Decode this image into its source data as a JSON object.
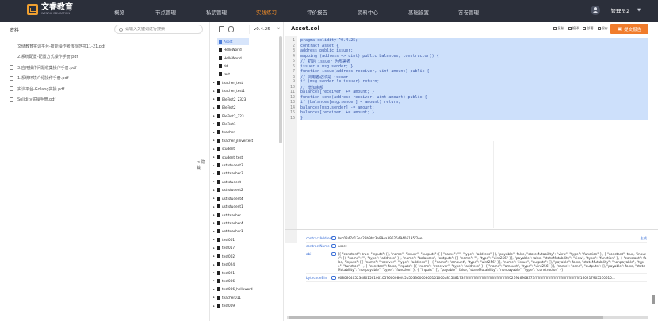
{
  "app": {
    "logo_cn": "文睿教育",
    "logo_en": "WENRUI EDUCATION"
  },
  "nav": {
    "items": [
      {
        "label": "概览",
        "active": false
      },
      {
        "label": "节点管理",
        "active": false
      },
      {
        "label": "私钥管理",
        "active": false
      },
      {
        "label": "实践练习",
        "active": true
      },
      {
        "label": "评价报告",
        "active": false
      },
      {
        "label": "资料中心",
        "active": false
      },
      {
        "label": "基础设置",
        "active": false
      },
      {
        "label": "答卷管理",
        "active": false
      }
    ],
    "user": "管理员2"
  },
  "left_panel": {
    "title": "资料",
    "search_placeholder": "请输入关键词进行搜索",
    "documents": [
      "文储教育实训平台-技能操作考核规范书11-21.pdf",
      "2.系统配置-配置方式操作手册.pdf",
      "3.应用操作问题收集操作手册.pdf",
      "1.系统环境介绍操作手册.pdf",
      "实训平台-Golang实操.pdf",
      "Solidity实操手册.pdf"
    ],
    "collapse_label": "< 隐藏"
  },
  "file_tree": {
    "version": "v0.4.25",
    "items": [
      {
        "label": "Asset",
        "kind": "file",
        "indent": 1,
        "selected": true
      },
      {
        "label": "HelloWorld",
        "kind": "file",
        "indent": 1
      },
      {
        "label": "HelloWorld",
        "kind": "file",
        "indent": 1
      },
      {
        "label": "dd",
        "kind": "file",
        "indent": 1
      },
      {
        "label": "test",
        "kind": "file",
        "indent": 1
      },
      {
        "label": "teacher_test",
        "kind": "folder"
      },
      {
        "label": "teacher_test1",
        "kind": "folder"
      },
      {
        "label": "BleTest2_2323",
        "kind": "folder"
      },
      {
        "label": "BleTest2",
        "kind": "folder"
      },
      {
        "label": "BleTest2_223",
        "kind": "folder"
      },
      {
        "label": "BleTest1",
        "kind": "folder"
      },
      {
        "label": "teacher",
        "kind": "folder"
      },
      {
        "label": "teacher_jlinvertest",
        "kind": "folder"
      },
      {
        "label": "student",
        "kind": "folder"
      },
      {
        "label": "student_test",
        "kind": "folder"
      },
      {
        "label": "ust-student3",
        "kind": "folder"
      },
      {
        "label": "ust-teacher3",
        "kind": "folder"
      },
      {
        "label": "ust-student",
        "kind": "folder"
      },
      {
        "label": "ust-student2",
        "kind": "folder"
      },
      {
        "label": "ust-student4",
        "kind": "folder"
      },
      {
        "label": "ust-student1",
        "kind": "folder"
      },
      {
        "label": "ust-teacher",
        "kind": "folder"
      },
      {
        "label": "ust-teacher4",
        "kind": "folder"
      },
      {
        "label": "ust-teacher1",
        "kind": "folder"
      },
      {
        "label": "test001",
        "kind": "folder"
      },
      {
        "label": "test017",
        "kind": "folder"
      },
      {
        "label": "test002",
        "kind": "folder"
      },
      {
        "label": "test024",
        "kind": "folder"
      },
      {
        "label": "test021",
        "kind": "folder"
      },
      {
        "label": "test006",
        "kind": "folder"
      },
      {
        "label": "test006_helloword",
        "kind": "folder"
      },
      {
        "label": "teacher011",
        "kind": "folder"
      },
      {
        "label": "test009",
        "kind": "folder"
      }
    ]
  },
  "editor": {
    "filename": "Asset.sol",
    "tools": [
      "复制",
      "编译",
      "部署",
      "保存"
    ],
    "submit_label": "提交报告",
    "lines": [
      "pragma solidity ^0.4.25;",
      "contract Asset {",
      "address public issuer;",
      "mapping (address => uint) public balances; constructor() {",
      "// 初始 issuer 为部署者",
      "issuer = msg.sender; }",
      "function issue(address receiver, uint amount) public {",
      "// 调用者必须是 issuer",
      "if (msg.sender != issuer) return;",
      "// 增加余额",
      "balances[receiver] += amount; }",
      "function send(address receiver, uint amount) public {",
      "if (balances[msg.sender] < amount) return;",
      "balances[msg.sender] -= amount;",
      "balances[receiver] += amount; }",
      "}"
    ]
  },
  "contract_info": {
    "rows": [
      {
        "key": "contractAddress",
        "value": "0xc0347d13ea29b9bc3a89ea3962549406195f2ee",
        "tag": "生成"
      },
      {
        "key": "contractName",
        "value": "Asset",
        "tag": ""
      },
      {
        "key": "abi",
        "value": "[{ \"constant\": true, \"inputs\": [], \"name\": \"issuer\", \"outputs\": [{ \"name\": \"\", \"type\": \"address\" }], \"payable\": false, \"stateMutability\": \"view\", \"type\": \"function\" }, { \"constant\": true, \"inputs\": [{ \"name\": \"\", \"type\": \"address\" }], \"name\": \"balances\", \"outputs\": [{ \"name\": \"\", \"type\": \"uint256\" }], \"payable\": false, \"stateMutability\": \"view\", \"type\": \"function\" }, { \"constant\": false, \"inputs\": [{ \"name\": \"receiver\", \"type\": \"address\" }, { \"name\": \"amount\", \"type\": \"uint256\" }], \"name\": \"issue\", \"outputs\": [], \"payable\": false, \"stateMutability\": \"nonpayable\", \"type\": \"function\" }, { \"constant\": false, \"inputs\": [{ \"name\": \"receiver\", \"type\": \"address\" }, { \"name\": \"amount\", \"type\": \"uint256\" }], \"name\": \"send\", \"outputs\": [], \"payable\": false, \"stateMutability\": \"nonpayable\", \"type\": \"function\" }, { \"inputs\": [], \"payable\": false, \"stateMutability\": \"nonpayable\", \"type\": \"constructor\" }]",
        "tag": ""
      },
      {
        "key": "bytecodeBin",
        "value": "608060405234801561001057600080fd5b50336000806101000a81548173ffffffffffffffffffffffffffffffffffffffff021916908373ffffffffffffffffffffffffffffffffffffffff160217905550610...",
        "tag": ""
      }
    ]
  }
}
